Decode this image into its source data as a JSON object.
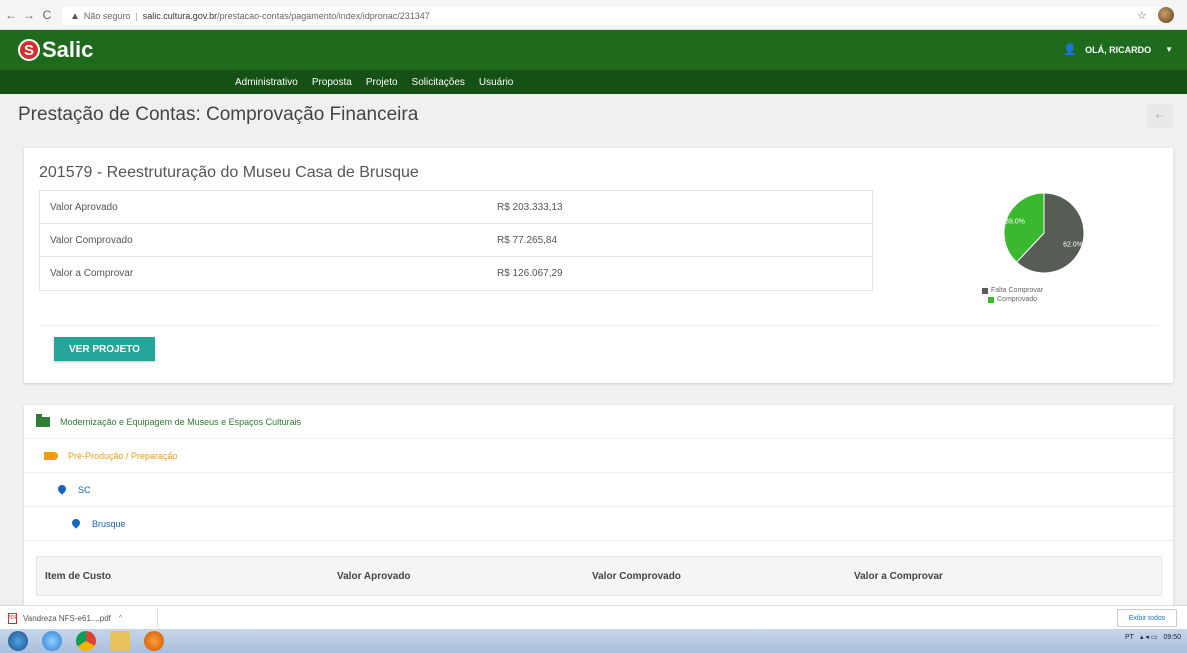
{
  "browser": {
    "security_label": "Não seguro",
    "url_host": "salic.cultura.gov.br",
    "url_path": "/prestacao-contas/pagamento/index/idpronac/231347"
  },
  "header": {
    "logo_text": "Salic",
    "user_label": "OLÁ, RICARDO"
  },
  "nav": {
    "items": [
      "Administrativo",
      "Proposta",
      "Projeto",
      "Solicitações",
      "Usuário"
    ]
  },
  "page": {
    "title": "Prestação de Contas: Comprovação Financeira"
  },
  "project": {
    "title": "201579 - Reestruturação do Museu Casa de Brusque",
    "rows": [
      {
        "label": "Valor Aprovado",
        "value": "R$ 203.333,13"
      },
      {
        "label": "Valor Comprovado",
        "value": "R$ 77.265,84"
      },
      {
        "label": "Valor a Comprovar",
        "value": "R$ 126.067,29"
      }
    ],
    "button_label": "VER PROJETO"
  },
  "chart_data": {
    "type": "pie",
    "categories": [
      "Falta Comprovar",
      "Comprovado"
    ],
    "values": [
      62.0,
      38.0
    ],
    "labels": [
      "62.0%",
      "38.0%"
    ],
    "colors": [
      "#555d55",
      "#3ab82e"
    ],
    "legend_position": "bottom"
  },
  "tree": {
    "area": "Modernização e Equipagem de Museus e Espaços Culturais",
    "stage": "Pré-Produção / Preparação",
    "state": "SC",
    "city": "Brusque"
  },
  "cost_table": {
    "headers": [
      "Item de Custo",
      "Valor Aprovado",
      "Valor Comprovado",
      "Valor a Comprovar"
    ]
  },
  "downloads": {
    "file_name": "Vandreza NFS-e61....pdf",
    "show_all": "Exibir todos"
  },
  "tray": {
    "lang": "PT",
    "time": "09:50"
  },
  "colors": {
    "header_green": "#1e6b1e",
    "nav_green": "#155015",
    "button_teal": "#26a69a",
    "stage_orange": "#f39c12",
    "location_blue": "#1565c0"
  }
}
